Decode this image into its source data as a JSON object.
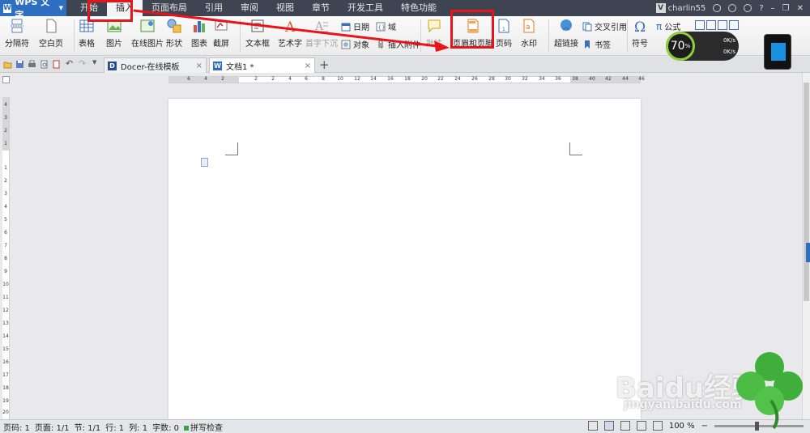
{
  "app": {
    "title": "WPS 文字"
  },
  "menu_tabs": [
    "开始",
    "插入",
    "页面布局",
    "引用",
    "审阅",
    "视图",
    "章节",
    "开发工具",
    "特色功能"
  ],
  "active_menu_tab": "插入",
  "user": {
    "name": "charlin55"
  },
  "ribbon": {
    "section_break": "分隔符",
    "blank_page": "空白页",
    "table": "表格",
    "picture": "图片",
    "online_picture": "在线图片",
    "shapes": "形状",
    "chart": "图表",
    "screenshot": "截屏",
    "textbox": "文本框",
    "wordart": "艺术字",
    "drop_cap": "首字下沉",
    "date": "日期",
    "object": "对象",
    "field": "域",
    "attachment": "插入附件",
    "batch": "批注",
    "header_footer": "页眉和页脚",
    "page_number": "页码",
    "watermark": "水印",
    "hyperlink": "超链接",
    "cross_ref": "交叉引用",
    "bookmark": "书签",
    "symbol": "符号",
    "formula": "公式"
  },
  "doc_tabs": [
    {
      "label": "Docer-在线模板",
      "close": "×"
    },
    {
      "label": "文档1 *",
      "close": "×"
    }
  ],
  "ruler_h_ticks": [
    "6",
    "4",
    "2",
    "2",
    "2",
    "4",
    "6",
    "8",
    "10",
    "12",
    "14",
    "16",
    "18",
    "20",
    "22",
    "24",
    "26",
    "28",
    "30",
    "32",
    "34",
    "36",
    "38",
    "40",
    "42",
    "44",
    "46"
  ],
  "ruler_v_ticks": [
    "4",
    "3",
    "2",
    "1",
    "1",
    "2",
    "3",
    "4",
    "5",
    "6",
    "7",
    "8",
    "9",
    "10",
    "11",
    "12",
    "13",
    "14",
    "15",
    "16",
    "17",
    "18",
    "19",
    "20",
    "21"
  ],
  "status": {
    "page_num": "页码: 1",
    "pages": "页面: 1/1",
    "section": "节: 1/1",
    "line": "行: 1",
    "col": "列: 1",
    "words": "字数: 0",
    "spell": "拼写检查",
    "zoom": "100 %"
  },
  "speed_widget": {
    "percent": "70",
    "unit": "%",
    "up": "0K/s",
    "down": "0K/s"
  },
  "watermark": {
    "brand": "Baidu经验",
    "url": "jingyan.baidu.com"
  },
  "colors": {
    "accent": "#2f6fc2",
    "highlight": "#e8141a",
    "titlebar": "#3f4452"
  }
}
